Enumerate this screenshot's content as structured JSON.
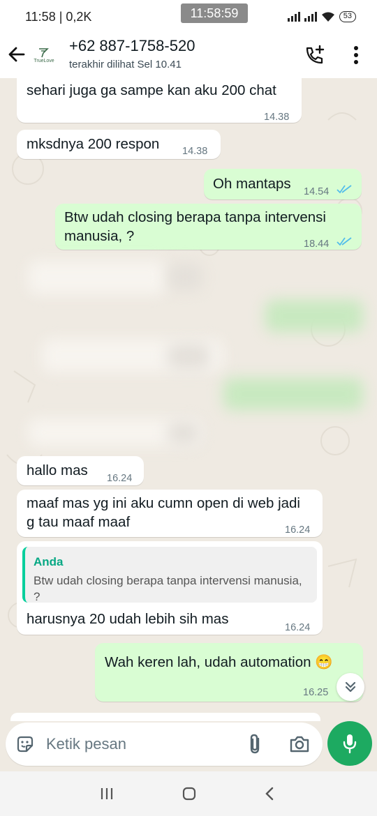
{
  "status_bar": {
    "left_text": "11:58 | 0,2K",
    "clock": "11:58:59",
    "battery": "53"
  },
  "header": {
    "contact_name": "+62 887-1758-520",
    "contact_status": "terakhir dilihat Sel 10.41",
    "avatar_logo_text": "TrueLove"
  },
  "messages": [
    {
      "direction": "in",
      "text": "sehari juga ga sampe kan aku 200 chat",
      "time": "14.38"
    },
    {
      "direction": "in",
      "text": "mksdnya 200 respon",
      "time": "14.38"
    },
    {
      "direction": "out",
      "text": "Oh mantaps",
      "time": "14.54",
      "status": "read"
    },
    {
      "direction": "out",
      "text": "Btw udah closing berapa tanpa intervensi manusia, ?",
      "time": "18.44",
      "status": "read"
    },
    {
      "direction": "in",
      "text": "hallo mas",
      "time": "16.24"
    },
    {
      "direction": "in",
      "text": "maaf mas yg ini aku cumn open di web jadi g tau maaf maaf",
      "time": "16.24"
    },
    {
      "direction": "in",
      "quote_author": "Anda",
      "quote_text": "Btw udah closing berapa tanpa intervensi manusia, ?",
      "text": "harusnya 20 udah lebih sih mas",
      "time": "16.24"
    },
    {
      "direction": "out",
      "text": "Wah keren lah, udah automation 😁",
      "time": "16.25"
    }
  ],
  "composer": {
    "placeholder": "Ketik pesan"
  },
  "colors": {
    "chat_bg": "#efeae2",
    "incoming": "#ffffff",
    "outgoing": "#d9fdd3",
    "accent_green": "#1daa61",
    "read_ticks": "#53bdeb"
  }
}
